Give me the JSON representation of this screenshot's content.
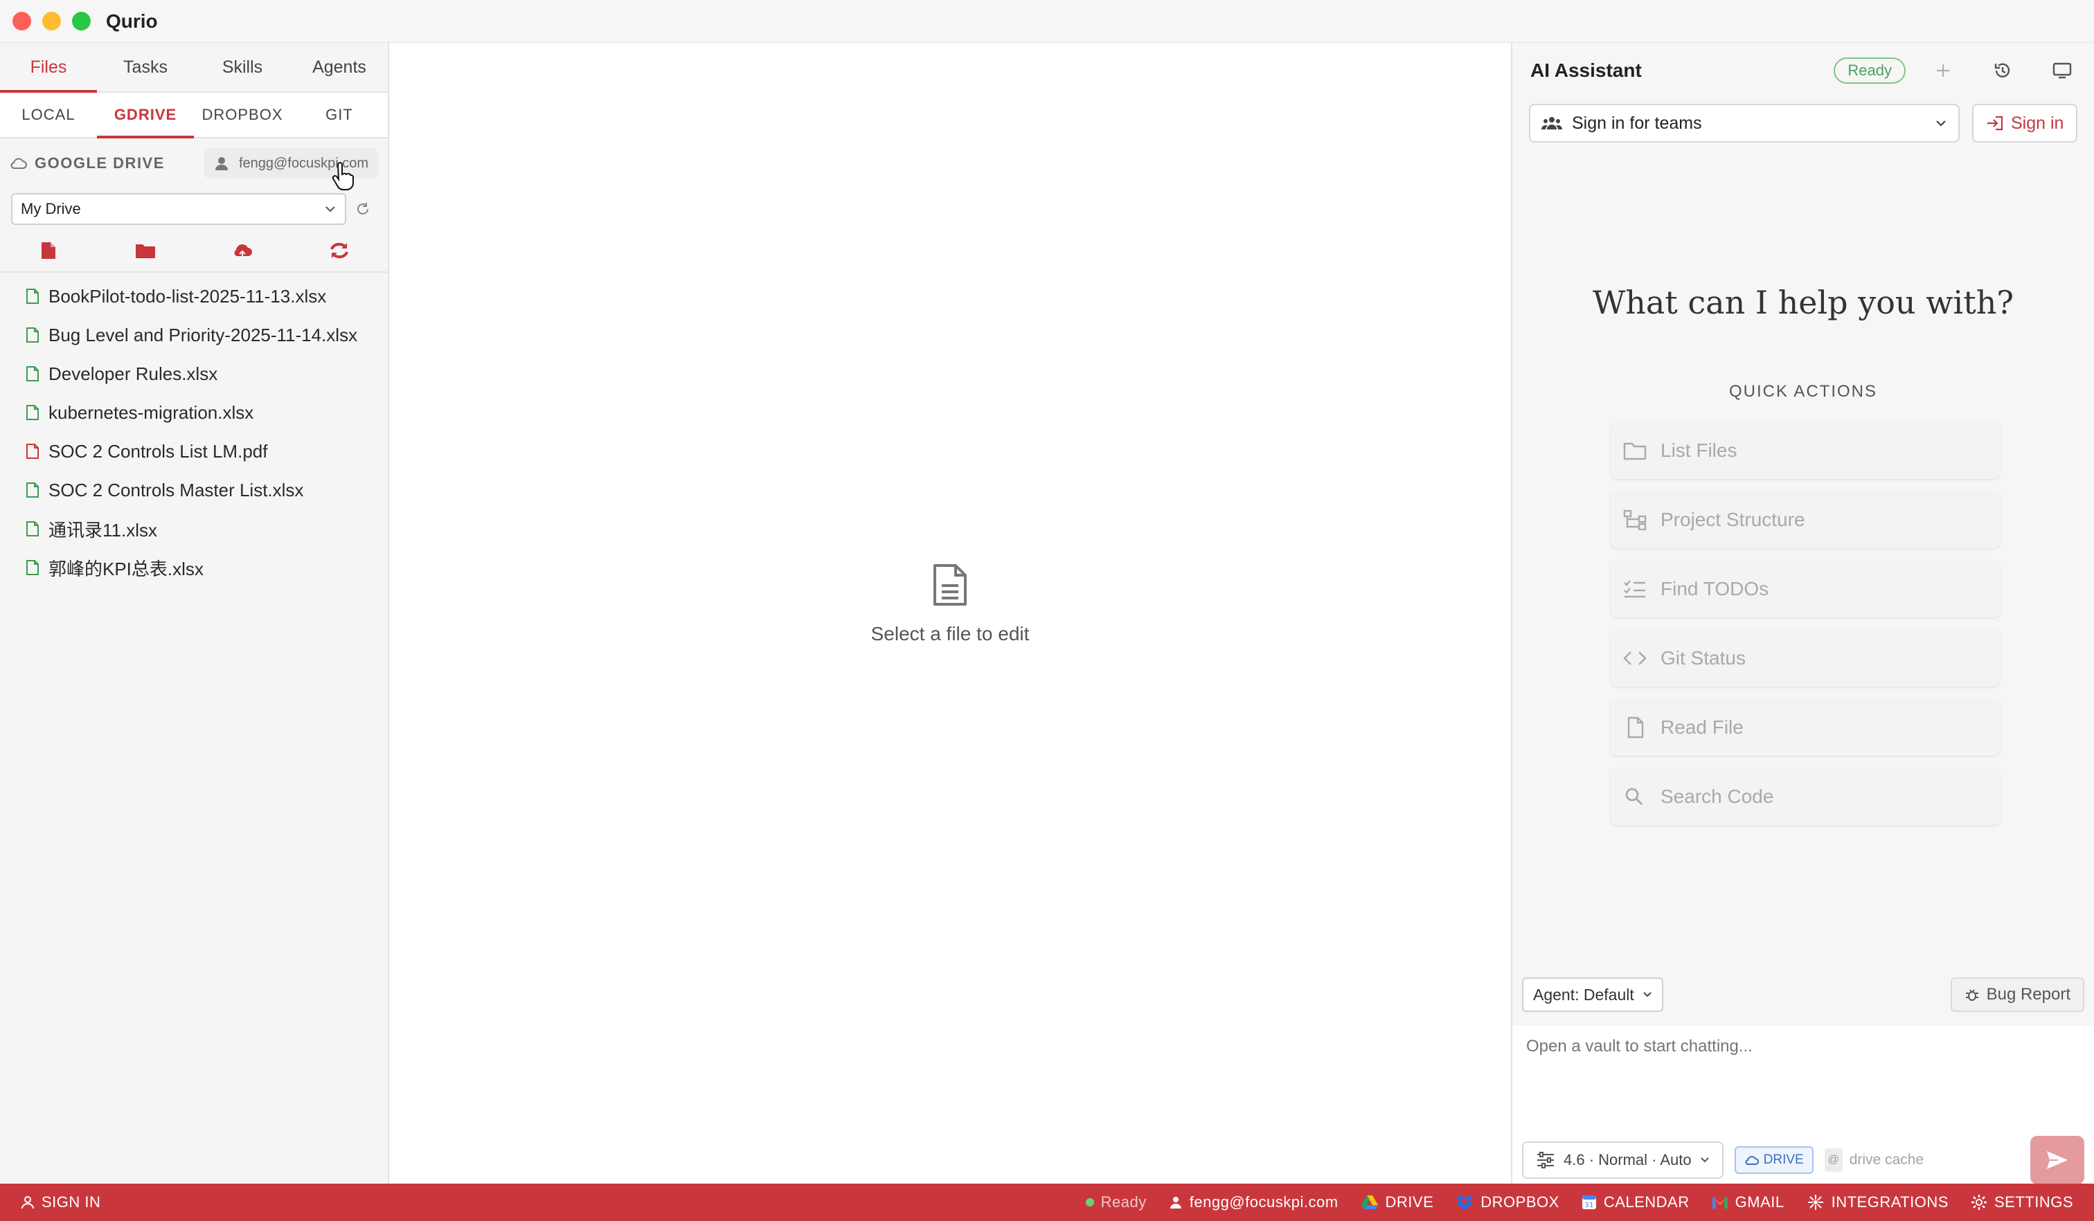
{
  "app": {
    "title": "Qurio"
  },
  "sidebar": {
    "main_tabs": [
      {
        "label": "Files",
        "active": true
      },
      {
        "label": "Tasks",
        "active": false
      },
      {
        "label": "Skills",
        "active": false
      },
      {
        "label": "Agents",
        "active": false
      }
    ],
    "source_tabs": [
      {
        "label": "LOCAL",
        "active": false
      },
      {
        "label": "GDRIVE",
        "active": true
      },
      {
        "label": "DROPBOX",
        "active": false
      },
      {
        "label": "GIT",
        "active": false
      }
    ],
    "drive_label": "GOOGLE DRIVE",
    "account_email": "fengg@focuskpi.com",
    "drive_select": {
      "value": "My Drive"
    },
    "toolbar_icons": [
      "new-file-icon",
      "new-folder-icon",
      "cloud-upload-icon",
      "sync-icon"
    ],
    "files": [
      {
        "name": "BookPilot-todo-list-2025-11-13.xlsx",
        "type": "xlsx"
      },
      {
        "name": "Bug Level and Priority-2025-11-14.xlsx",
        "type": "xlsx"
      },
      {
        "name": "Developer Rules.xlsx",
        "type": "xlsx"
      },
      {
        "name": "kubernetes-migration.xlsx",
        "type": "xlsx"
      },
      {
        "name": "SOC 2 Controls List LM.pdf",
        "type": "pdf"
      },
      {
        "name": "SOC 2 Controls Master List.xlsx",
        "type": "xlsx"
      },
      {
        "name": "通讯录11.xlsx",
        "type": "xlsx"
      },
      {
        "name": "郭峰的KPI总表.xlsx",
        "type": "xlsx"
      }
    ]
  },
  "editor": {
    "empty_label": "Select a file to edit"
  },
  "assistant": {
    "title": "AI Assistant",
    "status": "Ready",
    "team_select": "Sign in for teams",
    "sign_in_label": "Sign in",
    "welcome": "What can I help you with?",
    "quick_actions_title": "QUICK ACTIONS",
    "quick_actions": [
      {
        "label": "List Files",
        "icon": "folder-icon"
      },
      {
        "label": "Project Structure",
        "icon": "tree-icon"
      },
      {
        "label": "Find TODOs",
        "icon": "checklist-icon"
      },
      {
        "label": "Git Status",
        "icon": "code-icon"
      },
      {
        "label": "Read File",
        "icon": "file-icon"
      },
      {
        "label": "Search Code",
        "icon": "search-icon"
      }
    ],
    "agent_select": "Agent: Default",
    "bug_report_label": "Bug Report",
    "chat_placeholder": "Open a vault to start chatting...",
    "model_chip": "4.6 · Normal · Auto",
    "drive_chip": "DRIVE",
    "cache_placeholder": "drive cache"
  },
  "statusbar": {
    "sign_in": "SIGN IN",
    "ready": "Ready",
    "email": "fengg@focuskpi.com",
    "drive": "DRIVE",
    "dropbox": "DROPBOX",
    "calendar": "CALENDAR",
    "gmail": "GMAIL",
    "integrations": "INTEGRATIONS",
    "settings": "SETTINGS"
  },
  "colors": {
    "accent": "#c8363c",
    "statusbar": "#c9373d",
    "xlsx_icon": "#3f9a4e",
    "pdf_icon": "#c8363c",
    "ready_green": "#4aa35b"
  }
}
